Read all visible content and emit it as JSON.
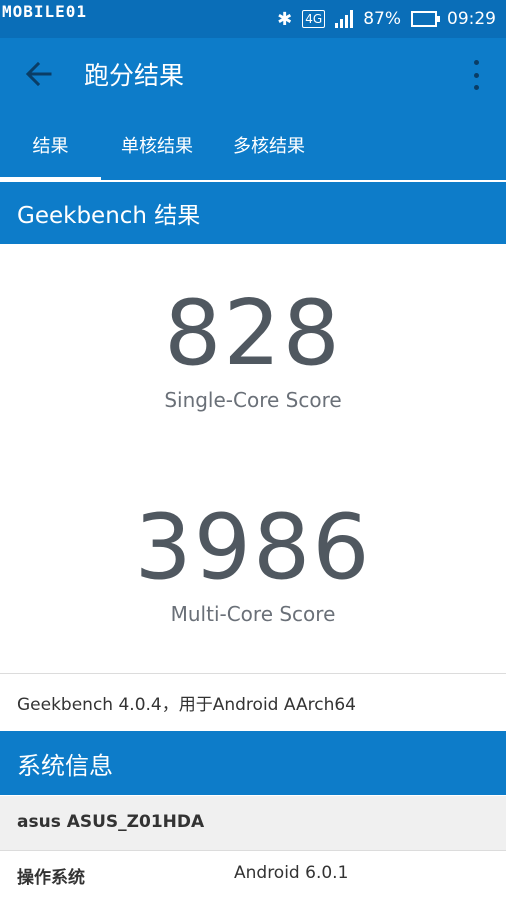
{
  "status_bar": {
    "watermark": "MOBILE01",
    "network": "4G",
    "battery": "87%",
    "battery_level": 0.87,
    "time": "09:29",
    "icons": [
      "bluetooth-icon",
      "network-4g-icon",
      "signal-icon",
      "battery-icon"
    ]
  },
  "app_bar": {
    "title": "跑分结果",
    "back_icon": "arrow-left-icon",
    "menu_icon": "more-vertical-icon"
  },
  "tabs": [
    {
      "label": "结果",
      "active": true
    },
    {
      "label": "单核结果",
      "active": false
    },
    {
      "label": "多核结果",
      "active": false
    }
  ],
  "results": {
    "header": "Geekbench 结果",
    "single_core": {
      "score": "828",
      "label": "Single-Core Score"
    },
    "multi_core": {
      "score": "3986",
      "label": "Multi-Core Score"
    },
    "version_line": "Geekbench 4.0.4，用于Android AArch64"
  },
  "system_info": {
    "header": "系统信息",
    "device": "asus ASUS_Z01HDA",
    "rows": [
      {
        "key": "操作系统",
        "value": "Android 6.0.1"
      }
    ]
  },
  "colors": {
    "primary": "#0d7cc9",
    "status_bar": "#0a6eb8",
    "score_text": "#505860"
  }
}
